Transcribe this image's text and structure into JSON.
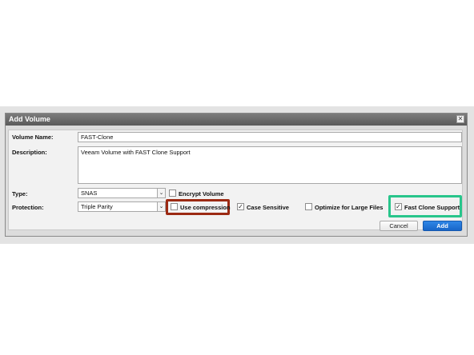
{
  "dialog": {
    "title": "Add Volume",
    "close_symbol": "✕"
  },
  "form": {
    "volume_name_label": "Volume Name:",
    "volume_name_value": "FAST-Clone",
    "description_label": "Description:",
    "description_value": "Veeam Volume with FAST Clone Support",
    "type_label": "Type:",
    "type_value": "SNAS",
    "protection_label": "Protection:",
    "protection_value": "Triple Parity",
    "dropdown_arrow": "⌄"
  },
  "options": {
    "encrypt_volume": {
      "label": "Encrypt Volume",
      "checked": false
    },
    "use_compression": {
      "label": "Use compression",
      "checked": false
    },
    "case_sensitive": {
      "label": "Case Sensitive",
      "checked": true
    },
    "optimize_large_files": {
      "label": "Optimize for Large Files",
      "checked": false
    },
    "fast_clone_support": {
      "label": "Fast Clone Support",
      "checked": true
    }
  },
  "buttons": {
    "cancel_label": "Cancel",
    "add_label": "Add"
  },
  "colors": {
    "highlight_red": "#9c2a13",
    "highlight_green": "#28c58b",
    "primary_button": "#1865c8"
  }
}
